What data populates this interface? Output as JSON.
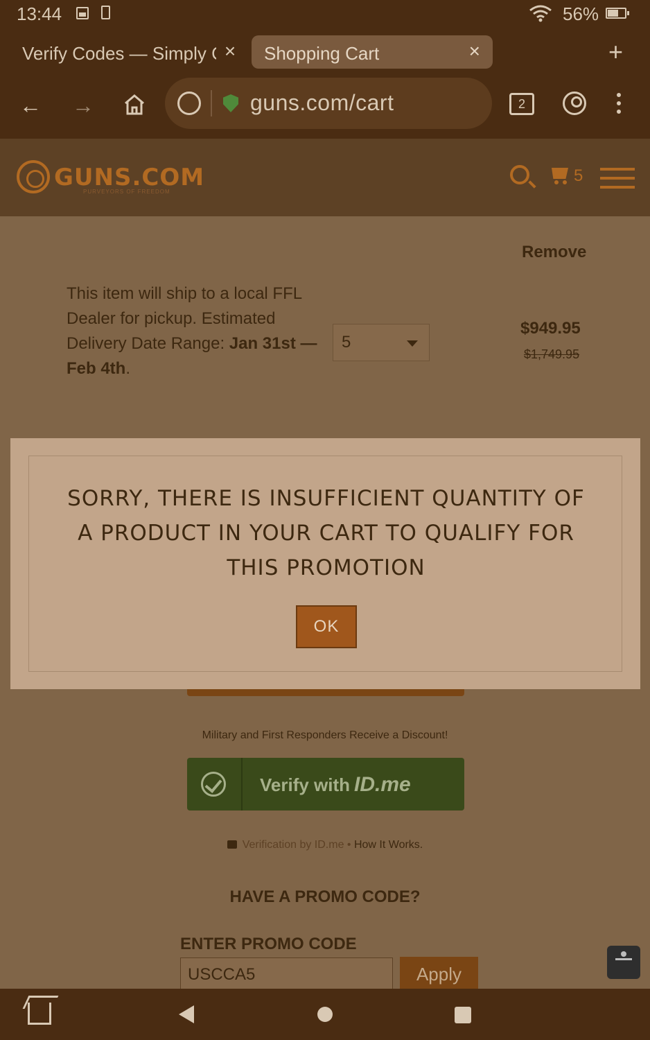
{
  "status_bar": {
    "time": "13:44",
    "battery": "56%"
  },
  "browser": {
    "tabs": [
      {
        "label": "Verify Codes — Simply Co"
      },
      {
        "label": "Shopping Cart",
        "active": true
      }
    ],
    "url": "guns.com/cart",
    "tab_count": "2"
  },
  "site": {
    "logo": "GUNS.COM",
    "tagline": "PURVEYORS OF FREEDOM",
    "cart_count": "5",
    "accent_color": "#b26a22"
  },
  "cart_item": {
    "remove_label": "Remove",
    "ship_line1": "This item will ship to a local FFL Dealer for pickup.",
    "ship_line2": "Estimated Delivery Date Range:",
    "ship_date": "Jan 31st — Feb 4th",
    "quantity": "5",
    "price": "$949.95",
    "original_price": "$1,749.95"
  },
  "modal": {
    "message": "SORRY, THERE IS INSUFFICIENT QUANTITY OF A PRODUCT IN YOUR CART TO QUALIFY FOR THIS PROMOTION",
    "ok_label": "OK"
  },
  "discount": {
    "text": "Military and First Responders Receive a Discount!",
    "verify_label": "Verify with",
    "verify_brand": "ID.me",
    "verification_by": "Verification by ID.me",
    "how_it_works": "How It Works."
  },
  "promo": {
    "question": "HAVE A PROMO CODE?",
    "label": "ENTER PROMO CODE",
    "value": "USCCA5",
    "apply_label": "Apply"
  }
}
